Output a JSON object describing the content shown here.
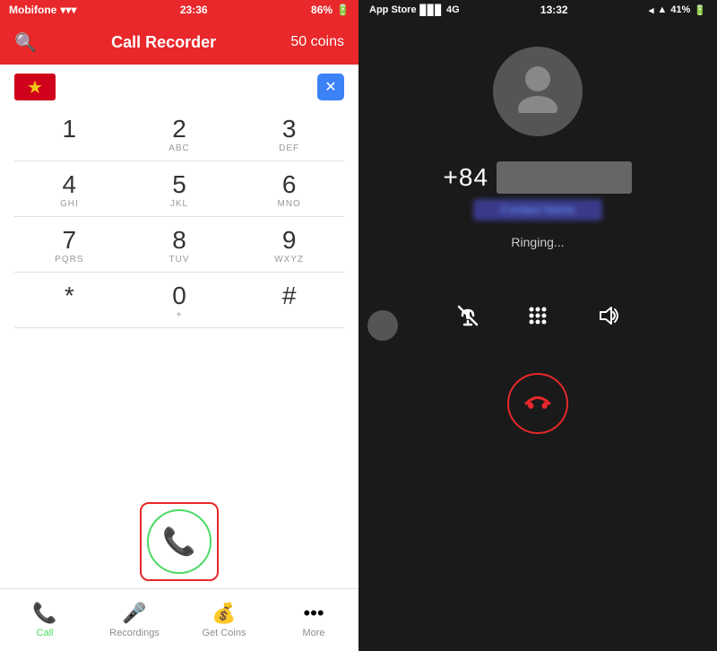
{
  "left": {
    "statusBar": {
      "carrier": "Mobifone",
      "time": "23:36",
      "battery": "86%"
    },
    "header": {
      "title": "Call Recorder",
      "coins": "50 coins"
    },
    "dialpad": {
      "keys": [
        {
          "num": "1",
          "letters": ""
        },
        {
          "num": "2",
          "letters": "ABC"
        },
        {
          "num": "3",
          "letters": "DEF"
        },
        {
          "num": "4",
          "letters": "GHI"
        },
        {
          "num": "5",
          "letters": "JKL"
        },
        {
          "num": "6",
          "letters": "MNO"
        },
        {
          "num": "7",
          "letters": "PQRS"
        },
        {
          "num": "8",
          "letters": "TUV"
        },
        {
          "num": "9",
          "letters": "WXYZ"
        },
        {
          "num": "*",
          "letters": ""
        },
        {
          "num": "0",
          "letters": "+"
        },
        {
          "num": "#",
          "letters": ""
        }
      ]
    },
    "tabs": [
      {
        "label": "Call",
        "icon": "📞",
        "active": true
      },
      {
        "label": "Recordings",
        "icon": "🎤",
        "active": false
      },
      {
        "label": "Get Coins",
        "icon": "💰",
        "active": false
      },
      {
        "label": "More",
        "icon": "···",
        "active": false
      }
    ]
  },
  "right": {
    "statusBar": {
      "carrier": "App Store",
      "signal": "4G",
      "time": "13:32",
      "battery": "41%"
    },
    "caller": {
      "number": "+84",
      "status": "Ringing..."
    }
  }
}
